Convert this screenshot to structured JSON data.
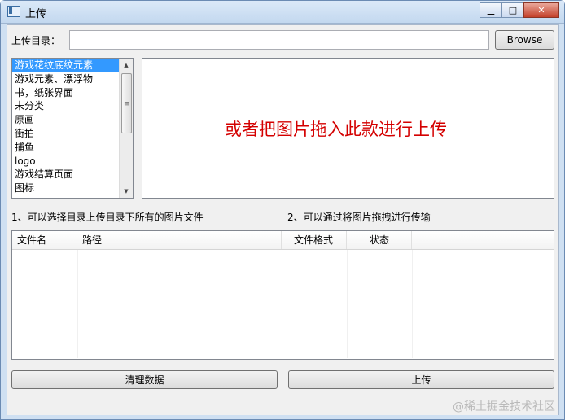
{
  "window": {
    "title": "上传"
  },
  "controls": {
    "minimize": "▁",
    "maximize": "□",
    "close": "✕"
  },
  "upload_dir": {
    "label": "上传目录：",
    "value": "",
    "browse_label": "Browse"
  },
  "categories": {
    "items": [
      "游戏花纹底纹元素",
      "游戏元素、漂浮物",
      "书，纸张界面",
      "未分类",
      "原画",
      "街拍",
      "捕鱼",
      "logo",
      "游戏结算页面",
      "图标"
    ],
    "selected_index": 0
  },
  "drop_zone": {
    "text": "或者把图片拖入此款进行上传"
  },
  "hints": {
    "hint1": "1、可以选择目录上传目录下所有的图片文件",
    "hint2": "2、可以通过将图片拖拽进行传输"
  },
  "table": {
    "columns": [
      "文件名",
      "路径",
      "文件格式",
      "状态"
    ],
    "rows": []
  },
  "actions": {
    "clear_label": "清理数据",
    "upload_label": "上传"
  },
  "watermark": "@稀土掘金技术社区",
  "colors": {
    "selection": "#3399ff",
    "drop_text": "#d40000"
  }
}
